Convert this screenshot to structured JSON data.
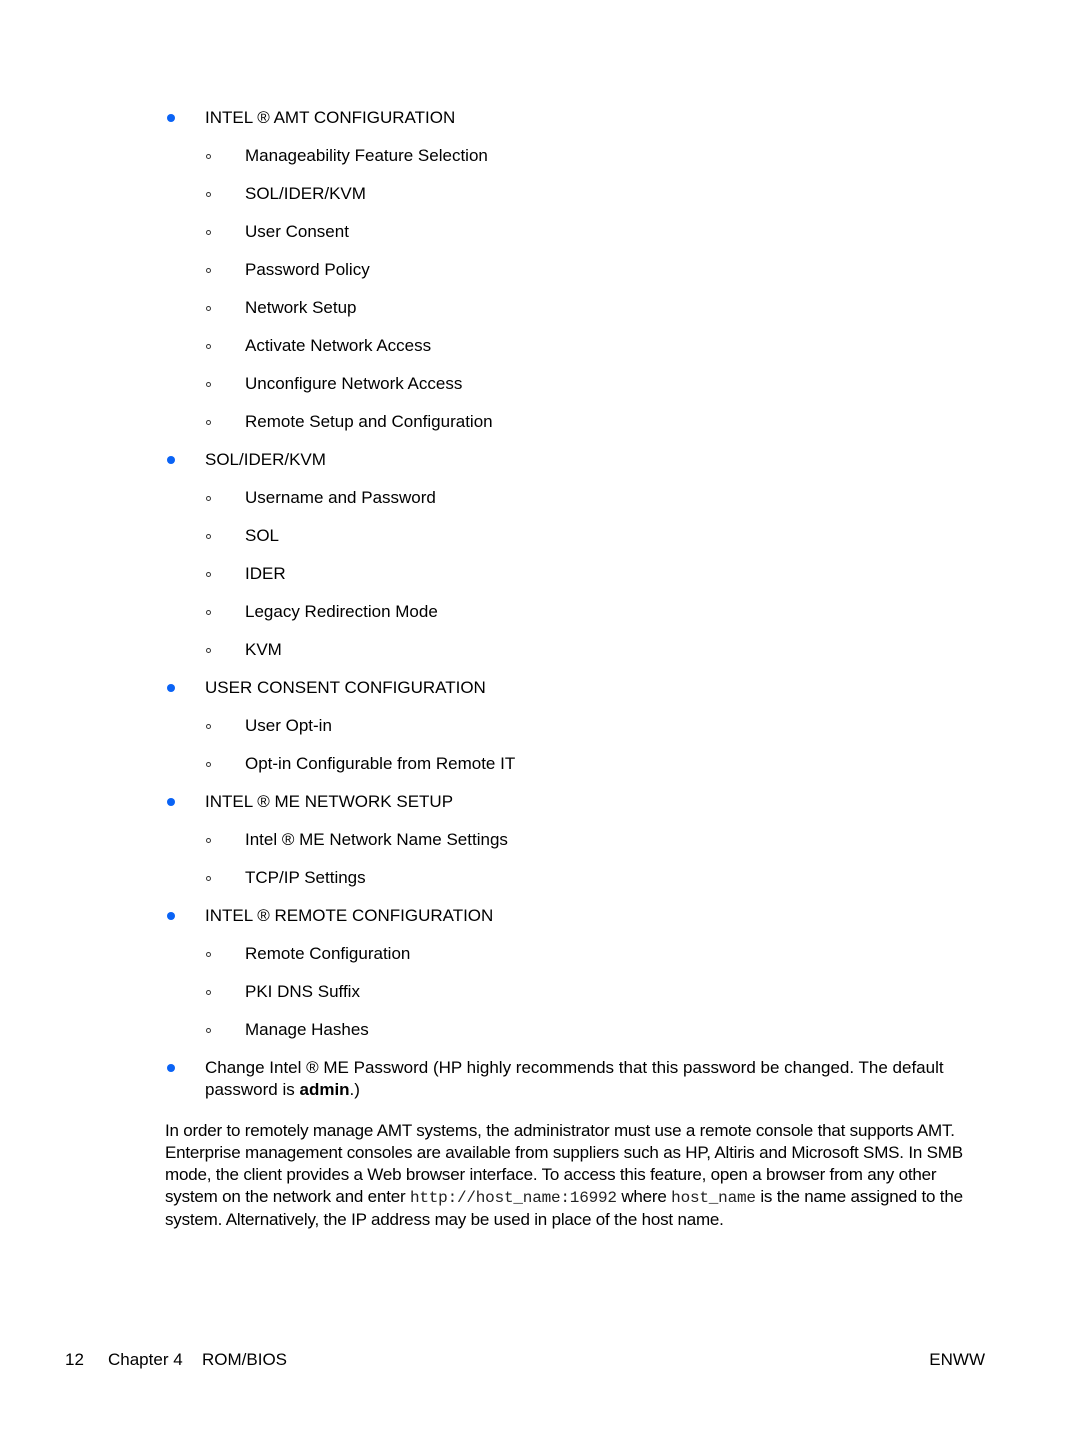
{
  "bullet_color": "#0a63f5",
  "sections": [
    {
      "title": "INTEL ® AMT CONFIGURATION",
      "items": [
        "Manageability Feature Selection",
        "SOL/IDER/KVM",
        "User Consent",
        "Password Policy",
        "Network Setup",
        "Activate Network Access",
        "Unconfigure Network Access",
        "Remote Setup and Configuration"
      ]
    },
    {
      "title": "SOL/IDER/KVM",
      "items": [
        "Username and Password",
        "SOL",
        "IDER",
        "Legacy Redirection Mode",
        "KVM"
      ]
    },
    {
      "title": "USER CONSENT CONFIGURATION",
      "items": [
        "User Opt-in",
        "Opt-in Configurable from Remote IT"
      ]
    },
    {
      "title": "INTEL ® ME NETWORK SETUP",
      "items": [
        "Intel ® ME Network Name Settings",
        "TCP/IP Settings"
      ]
    },
    {
      "title": "INTEL ® REMOTE CONFIGURATION",
      "items": [
        "Remote Configuration",
        "PKI DNS Suffix",
        "Manage Hashes"
      ]
    }
  ],
  "password_note": {
    "prefix": "Change Intel ® ME Password (HP highly recommends that this password be changed. The default password is ",
    "bold": "admin",
    "suffix": ".)"
  },
  "paragraph": {
    "part1": "In order to remotely manage AMT systems, the administrator must use a remote console that supports AMT. Enterprise management consoles are available from suppliers such as HP, Altiris and Microsoft SMS. In SMB mode, the client provides a Web browser interface. To access this feature, open a browser from any other system on the network and enter ",
    "code1": "http://host_name:16992",
    "part2": " where ",
    "code2": "host_name",
    "part3": " is the name assigned to the system. Alternatively, the IP address may be used in place of the host name."
  },
  "footer": {
    "page_number": "12",
    "chapter": "Chapter 4",
    "section": "ROM/BIOS",
    "locale": "ENWW"
  }
}
